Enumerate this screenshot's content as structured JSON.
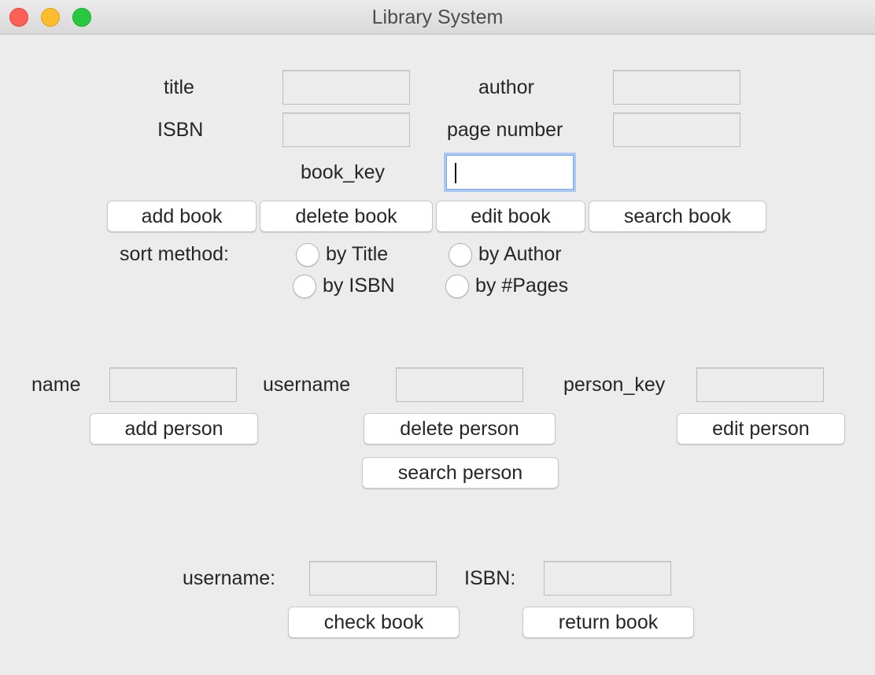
{
  "window": {
    "title": "Library System"
  },
  "book": {
    "title_label": "title",
    "author_label": "author",
    "isbn_label": "ISBN",
    "pages_label": "page number",
    "key_label": "book_key",
    "title_value": "",
    "author_value": "",
    "isbn_value": "",
    "pages_value": "",
    "key_value": "",
    "add_label": "add book",
    "delete_label": "delete book",
    "edit_label": "edit book",
    "search_label": "search book",
    "sort_label": "sort method:",
    "sort_options": {
      "title": "by Title",
      "author": "by Author",
      "isbn": "by ISBN",
      "pages": "by #Pages"
    }
  },
  "person": {
    "name_label": "name",
    "username_label": "username",
    "key_label": "person_key",
    "name_value": "",
    "username_value": "",
    "key_value": "",
    "add_label": "add person",
    "delete_label": "delete person",
    "edit_label": "edit person",
    "search_label": "search person"
  },
  "checkout": {
    "username_label": "username:",
    "isbn_label": "ISBN:",
    "username_value": "",
    "isbn_value": "",
    "check_label": "check book",
    "return_label": "return book"
  },
  "colors": {
    "close": "#fe5f57",
    "minimize": "#febc2e",
    "zoom": "#28c840",
    "focus_ring": "#a9c8f2",
    "background": "#ececec"
  }
}
